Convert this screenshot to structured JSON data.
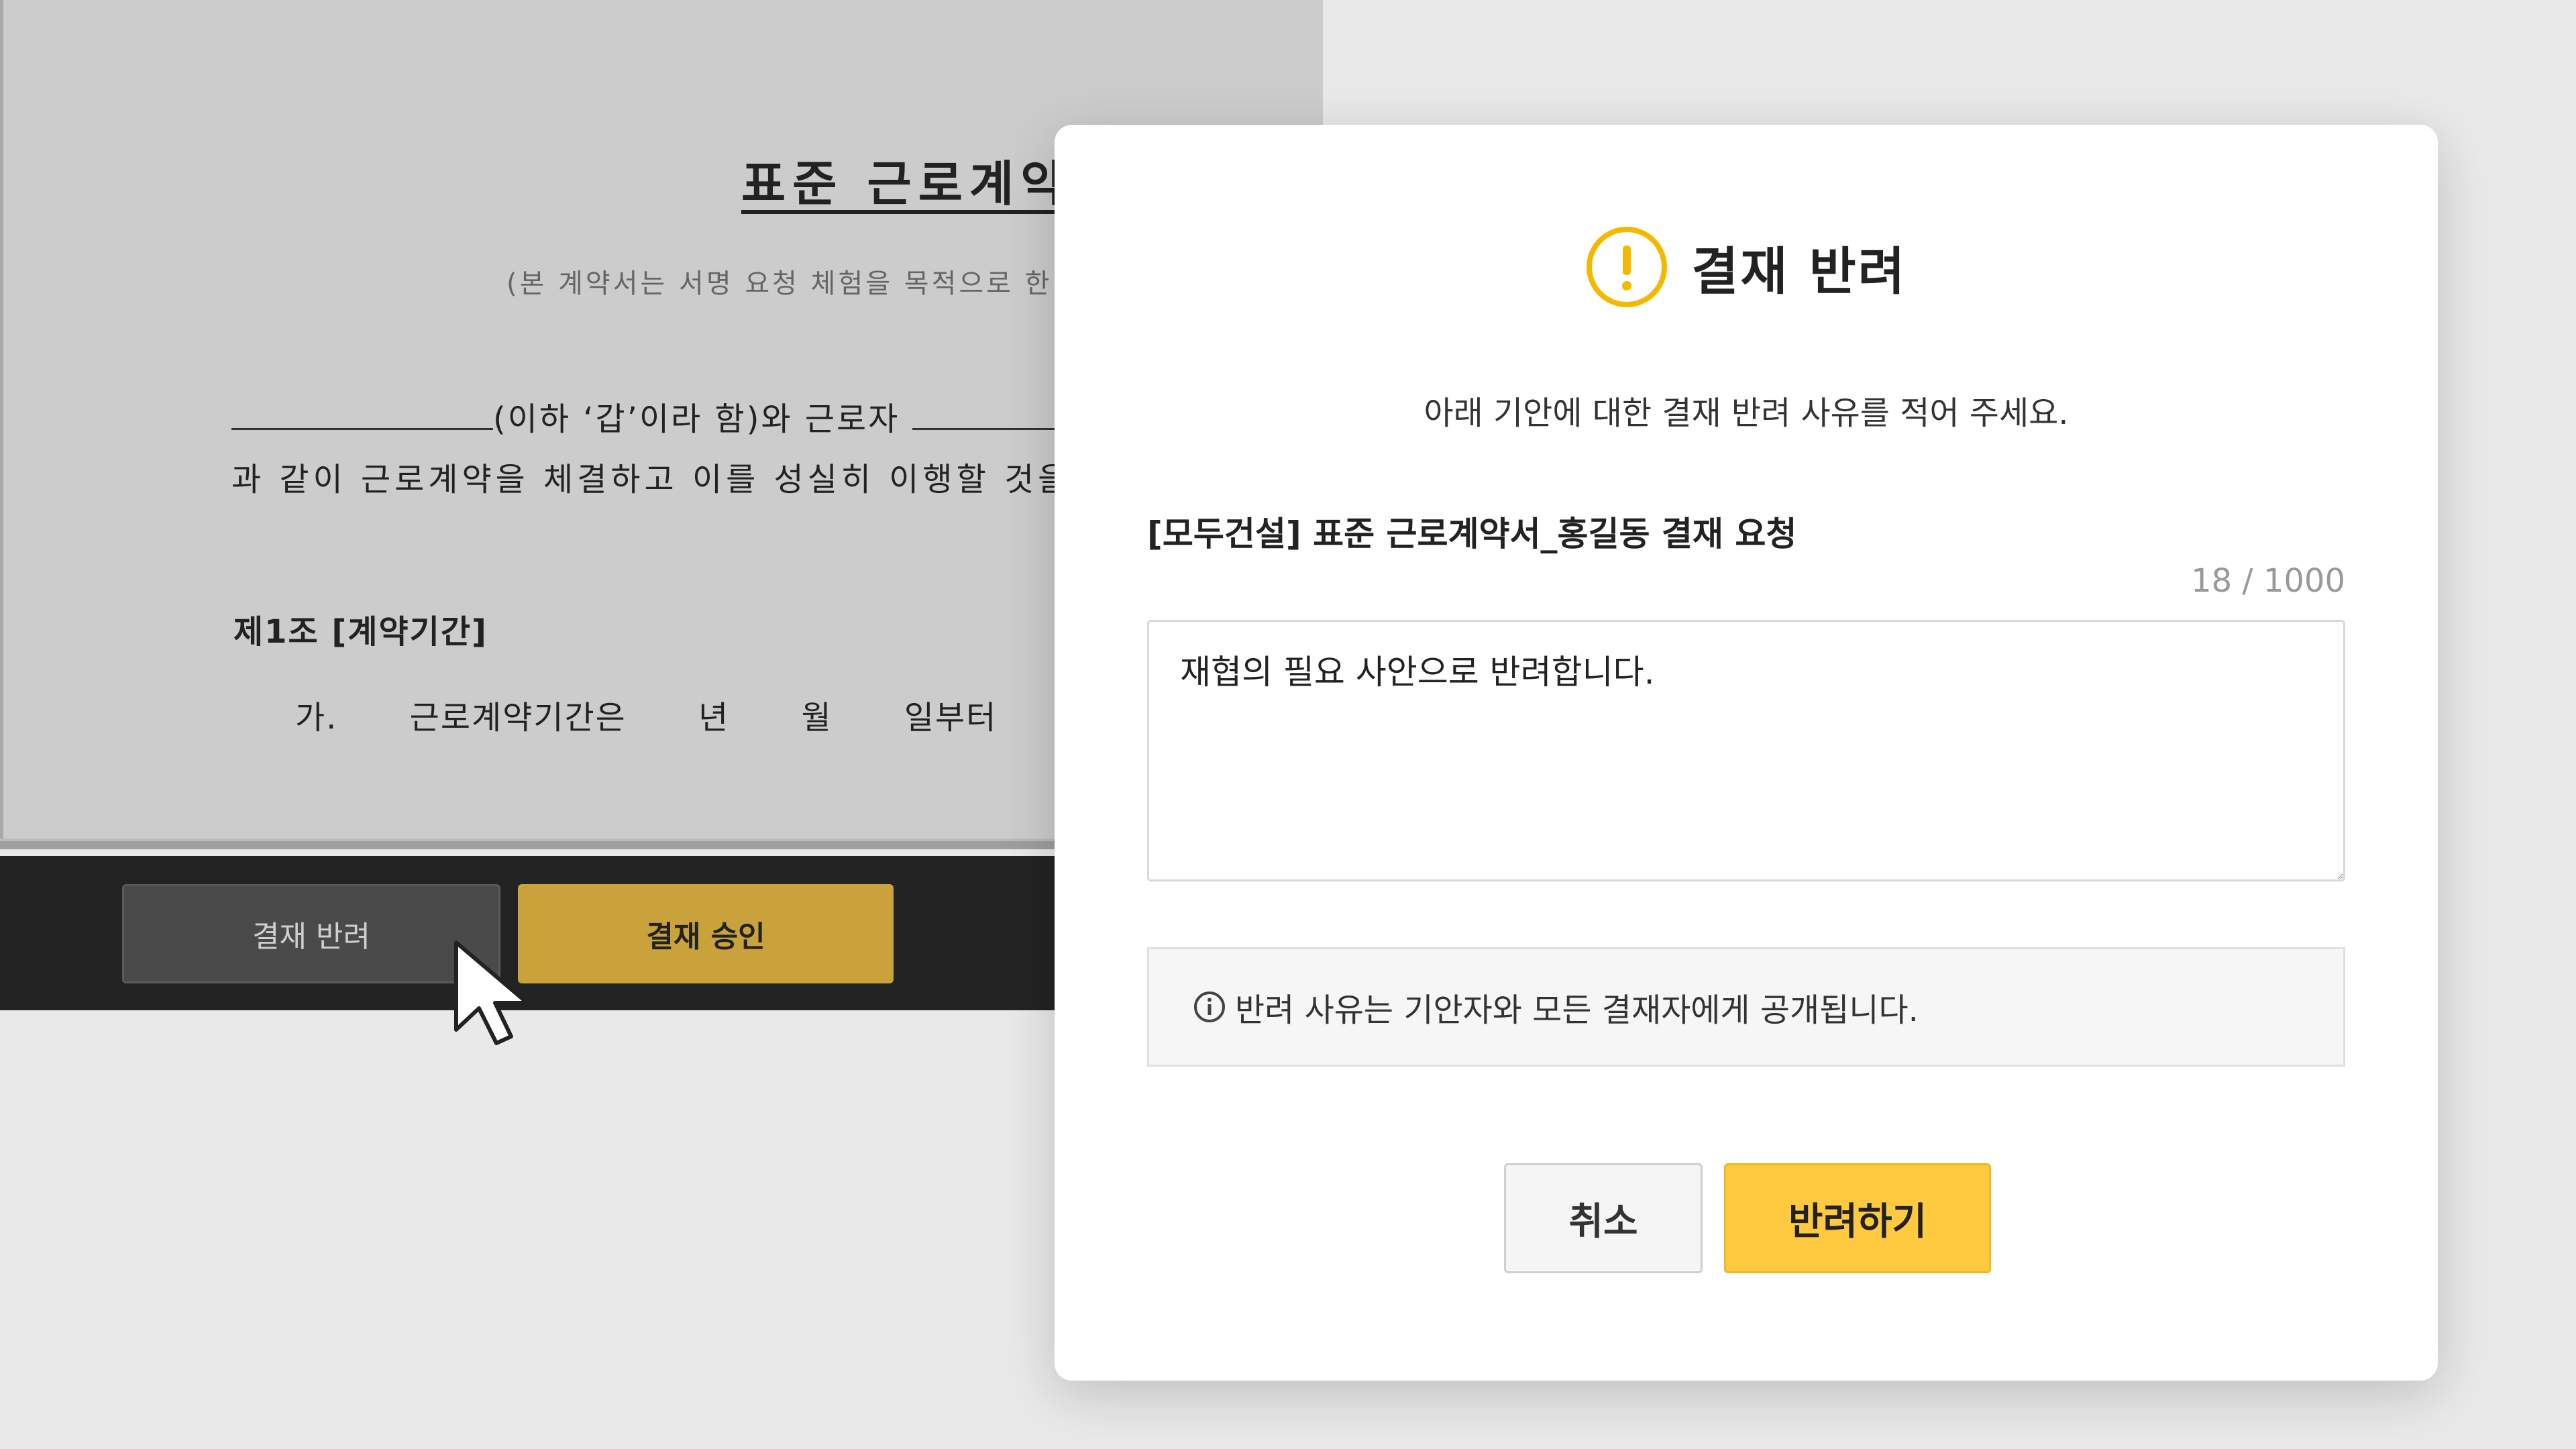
{
  "document": {
    "title": "표준 근로계약",
    "subtitle": "(본 계약서는 서명 요청 체험을 목적으로 한",
    "line1_mid": "(이하 ‘갑’이라 함)와 근로자",
    "line2": "과 같이 근로계약을 체결하고 이를 성실히 이행할 것을",
    "article_heading": "제1조 [계약기간]",
    "clause_text": "가. 근로계약기간은 년 월 일부터"
  },
  "action_bar": {
    "reject_label": "결재 반려",
    "approve_label": "결재 승인"
  },
  "modal": {
    "title": "결재 반려",
    "instruction": "아래 기안에 대한 결재 반려 사유를 적어 주세요.",
    "document_name": "[모두건설] 표준 근로계약서_홍길동 결재 요청",
    "char_counter": "18 / 1000",
    "reason_value": "재협의 필요 사안으로 반려합니다.",
    "notice": "반려 사유는 기안자와 모든 결재자에게 공개됩니다.",
    "cancel_label": "취소",
    "submit_label": "반려하기"
  },
  "icons": {
    "warning": "warning-icon",
    "info": "info-icon",
    "cursor": "mouse-cursor"
  },
  "colors": {
    "accent_yellow": "#ffc940",
    "warning_icon": "#f5b800",
    "approve_button": "#c9a23b",
    "action_bar_bg": "#232323"
  }
}
